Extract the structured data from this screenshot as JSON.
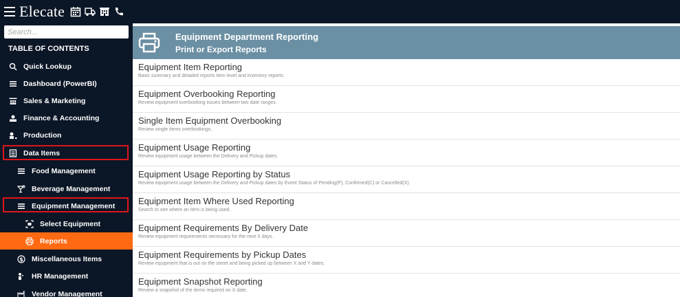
{
  "topbar": {
    "brand": "Elecate",
    "icons": [
      "menu-icon",
      "calendar-icon",
      "truck-icon",
      "building-icon",
      "phone-icon"
    ]
  },
  "sidebar": {
    "search_placeholder": "Search...",
    "toc_label": "TABLE OF CONTENTS",
    "items": [
      {
        "label": "Quick Lookup",
        "icon": "search-icon"
      },
      {
        "label": "Dashboard (PowerBI)",
        "icon": "bars-icon"
      },
      {
        "label": "Sales & Marketing",
        "icon": "people-icon"
      },
      {
        "label": "Finance & Accounting",
        "icon": "money-icon"
      },
      {
        "label": "Production",
        "icon": "production-icon"
      },
      {
        "label": "Data Items",
        "icon": "data-icon"
      },
      {
        "label": "Food Management",
        "icon": "bars-icon"
      },
      {
        "label": "Beverage Management",
        "icon": "cocktail-icon"
      },
      {
        "label": "Equipment Management",
        "icon": "bars-icon"
      },
      {
        "label": "Select Equipment",
        "icon": "select-icon"
      },
      {
        "label": "Reports",
        "icon": "printer-icon"
      },
      {
        "label": "Miscellaneous Items",
        "icon": "dollar-icon"
      },
      {
        "label": "HR Management",
        "icon": "person-icon"
      },
      {
        "label": "Vendor Management",
        "icon": "factory-icon"
      }
    ]
  },
  "header": {
    "title": "Equipment Department Reporting",
    "subtitle": "Print or Export Reports",
    "icon": "printer-icon"
  },
  "reports": [
    {
      "title": "Equipment Item Reporting",
      "desc": "Basic summary and detailed reports item level and inventory reports."
    },
    {
      "title": "Equipment Overbooking Reporting",
      "desc": "Review equipment overbooking issues between two date ranges."
    },
    {
      "title": "Single Item Equipment Overbooking",
      "desc": "Review single items overbookings."
    },
    {
      "title": "Equipment Usage Reporting",
      "desc": "Review equipment usage between the Delivery and Pickup dates."
    },
    {
      "title": "Equipment Usage Reporting by Status",
      "desc": "Review equipment usage between the Delivery and Pickup dates by Event Status of Pending(P), Confirmed(C) or Cancelled(X)."
    },
    {
      "title": "Equipment Item Where Used Reporting",
      "desc": "Search to see where an item is being used."
    },
    {
      "title": "Equipment Requirements By Delivery Date",
      "desc": "Review equipment requirements necessary for the next X days."
    },
    {
      "title": "Equipment Requirements by Pickup Dates",
      "desc": "Review equipment that is out on the street and being picked up between X and Y dates."
    },
    {
      "title": "Equipment Snapshot Reporting",
      "desc": "Review a snapshot of the items required on X date."
    }
  ],
  "colors": {
    "sidebar_bg": "#0b1626",
    "header_bg": "#6b8fa3",
    "active_item": "#ff6a13",
    "highlight_border": "#e0151c"
  }
}
